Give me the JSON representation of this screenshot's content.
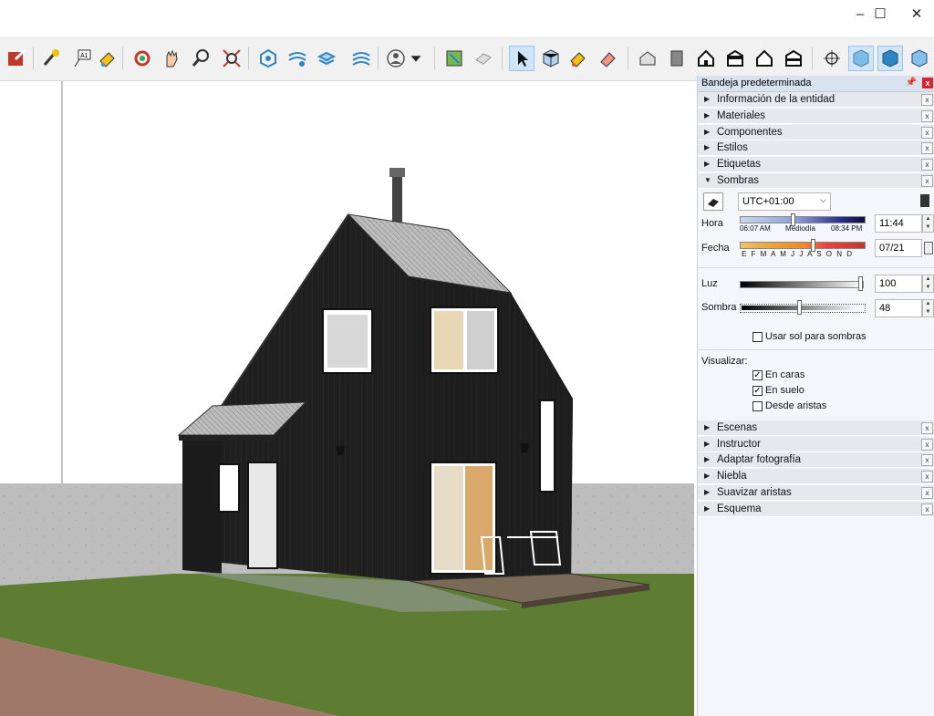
{
  "window": {
    "minimize": "–",
    "maximize": "☐",
    "close": "✕"
  },
  "toolbar": {
    "icons": [
      "select-icon",
      "section-plane-icon",
      "paint-bucket-icon",
      "eraser-icon",
      "orbit-icon",
      "pan-icon",
      "zoom-icon",
      "zoom-extents-icon"
    ]
  },
  "tray": {
    "title": "Bandeja predeterminada",
    "pin": "📌",
    "close": "x",
    "panels_top": [
      {
        "label": "Información de la entidad",
        "arrow": "▶"
      },
      {
        "label": "Materiales",
        "arrow": "▶"
      },
      {
        "label": "Componentes",
        "arrow": "▶"
      },
      {
        "label": "Estilos",
        "arrow": "▶"
      },
      {
        "label": "Etiquetas",
        "arrow": "▶"
      }
    ],
    "shadows": {
      "label": "Sombras",
      "arrow": "▼",
      "timezone": "UTC+01:00",
      "hora_label": "Hora",
      "time_start": "06:07 AM",
      "time_mid": "Mediodía",
      "time_end": "08:34 PM",
      "time_value": "11:44",
      "fecha_label": "Fecha",
      "months": "E F M A M J J A S O N D",
      "date_value": "07/21",
      "luz_label": "Luz",
      "luz_value": "100",
      "sombra_label": "Sombra",
      "sombra_value": "48",
      "use_sun_label": "Usar sol para sombras",
      "use_sun_checked": false,
      "visualizar_label": "Visualizar:",
      "on_faces_label": "En caras",
      "on_faces_checked": true,
      "on_ground_label": "En suelo",
      "on_ground_checked": true,
      "from_edges_label": "Desde aristas",
      "from_edges_checked": false
    },
    "panels_bottom": [
      {
        "label": "Escenas",
        "arrow": "▶"
      },
      {
        "label": "Instructor",
        "arrow": "▶"
      },
      {
        "label": "Adaptar fotografía",
        "arrow": "▶"
      },
      {
        "label": "Niebla",
        "arrow": "▶"
      },
      {
        "label": "Suavizar aristas",
        "arrow": "▶"
      },
      {
        "label": "Esquema",
        "arrow": "▶"
      }
    ],
    "panel_close": "x"
  },
  "colors": {
    "house": "#1e1e1e",
    "grass": "#5e7d33",
    "soil": "#a0786a",
    "wall": "#b9b9b9",
    "accent": "#cfe5fa"
  }
}
